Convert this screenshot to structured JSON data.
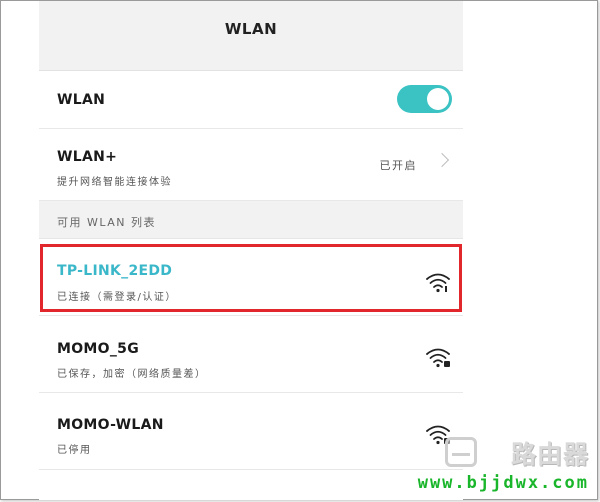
{
  "header": {
    "title": "WLAN"
  },
  "wlan_row": {
    "label": "WLAN",
    "enabled": true
  },
  "wlan_plus": {
    "label": "WLAN+",
    "description": "提升网络智能连接体验",
    "status": "已开启"
  },
  "section": {
    "label": "可用 WLAN 列表"
  },
  "networks": [
    {
      "ssid": "TP-LINK_2EDD",
      "status": "已连接（需登录/认证）",
      "connected": true
    },
    {
      "ssid": "MOMO_5G",
      "status": "已保存，加密（网络质量差）",
      "connected": false
    },
    {
      "ssid": "MOMO-WLAN",
      "status": "已停用",
      "connected": false
    }
  ],
  "watermark": {
    "brand": "路由器",
    "url": "www.bjjdwx.com"
  },
  "colors": {
    "accent": "#3bc3c4",
    "connected_text": "#3ab7c9",
    "highlight": "#e1262c",
    "url": "#19b52a"
  }
}
